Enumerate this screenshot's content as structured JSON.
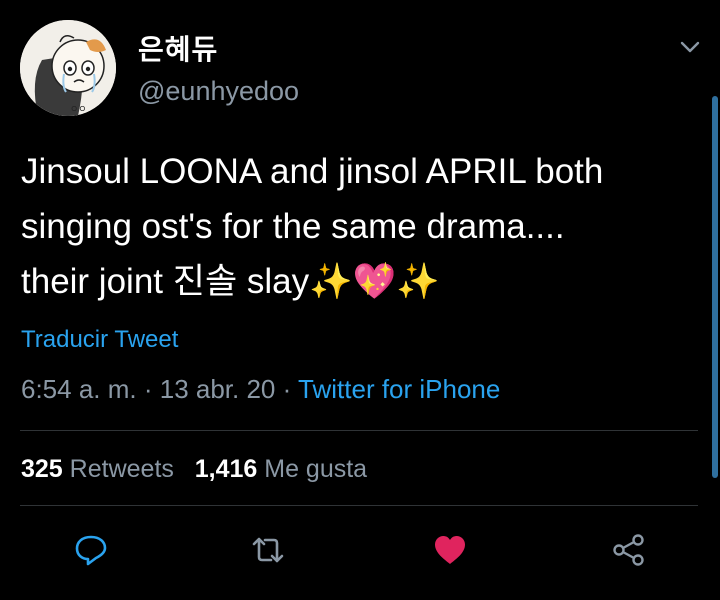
{
  "author": {
    "display_name": "은혜듀",
    "handle": "@eunhyedoo"
  },
  "tweet": {
    "line1": "Jinsoul LOONA and jinsol APRIL both",
    "line2": "singing ost's for the same drama....",
    "line3_text": "their joint 진솔 slay",
    "emoji_sparkle": "✨",
    "emoji_heart": "💖"
  },
  "translate_label": "Traducir Tweet",
  "meta": {
    "time": "6:54 a. m.",
    "sep1": " · ",
    "date": "13 abr. 20",
    "sep2": " · ",
    "source": "Twitter for iPhone"
  },
  "stats": {
    "retweets_count": "325",
    "retweets_label": "Retweets",
    "likes_count": "1,416",
    "likes_label": "Me gusta"
  },
  "icons": {
    "reply": "reply-icon",
    "retweet": "retweet-icon",
    "like": "heart-icon",
    "share": "share-icon",
    "menu": "chevron-down-icon"
  },
  "colors": {
    "background": "#000000",
    "link": "#2aa3ef",
    "secondary_text": "#8b98a5",
    "like": "#e0245e"
  }
}
